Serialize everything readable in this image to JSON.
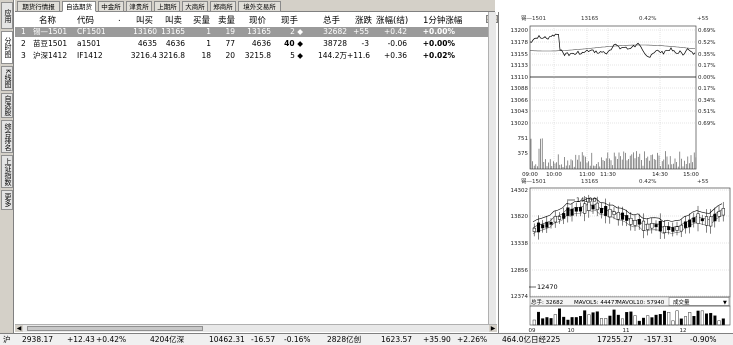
{
  "sidebar": [
    "应用",
    "分时图",
    "K线图",
    "自选股",
    "综合排名",
    "上证指数",
    "更多"
  ],
  "tabs": [
    "期货行情报",
    "自选期货",
    "中金所",
    "津贵所",
    "上期所",
    "大商所",
    "郑商所",
    "境外交易所"
  ],
  "nav_arrows": "◀▶",
  "columns": [
    "名称",
    "代码",
    ".",
    "叫买",
    "叫卖",
    "买量",
    "卖量",
    "现价",
    "现手",
    "总手",
    "涨跌",
    "涨幅(结)",
    "1分钟涨幅"
  ],
  "rows": [
    {
      "idx": "1",
      "name": "锡—1501",
      "code": "CF1501",
      "bid": "13160",
      "ask": "13165",
      "bidvol": "1",
      "askvol": "19",
      "price": "13165",
      "cur": "2 ◆",
      "total": "32682",
      "chg": "+55",
      "pct": "+0.42",
      "min1": "+0.00%"
    },
    {
      "idx": "2",
      "name": "苗豆1501",
      "code": "a1501",
      "bid": "4635",
      "ask": "4636",
      "bidvol": "1",
      "askvol": "77",
      "price": "4636",
      "cur": "40 ◆",
      "total": "38728",
      "chg": "-3",
      "pct": "-0.06",
      "min1": "+0.00%"
    },
    {
      "idx": "3",
      "name": "沪深1412",
      "code": "IF1412",
      "bid": "3216.4",
      "ask": "3216.8",
      "bidvol": "18",
      "askvol": "20",
      "price": "3215.8",
      "cur": "5 ◆",
      "total": "144.2万",
      "chg": "+11.6",
      "pct": "+0.36",
      "min1": "+0.02%"
    }
  ],
  "intraday": {
    "header": {
      "name": "锡—1501",
      "price": "13165",
      "pct": "0.42%",
      "chg": "+55"
    },
    "left_ticks": [
      "13200",
      "13178",
      "13155",
      "13133",
      "13110",
      "13088",
      "13066",
      "13043",
      "13020",
      "751",
      "375"
    ],
    "right_ticks": [
      "0.69%",
      "0.52%",
      "0.35%",
      "0.17%",
      "0.00%",
      "0.17%",
      "0.34%",
      "0.51%",
      "0.69%"
    ],
    "time_ticks": [
      "09:00",
      "10:00",
      "11:00",
      "11:30",
      "14:30",
      "15:00"
    ]
  },
  "kline": {
    "header": {
      "name": "锡—1501",
      "price": "13165",
      "pct": "0.42%",
      "chg": "+55"
    },
    "left_ticks": [
      "14302",
      "13820",
      "13338",
      "12856",
      "12374"
    ],
    "high_label": "14100",
    "low_label": "12470",
    "indicator": {
      "vol": "总手: 32682",
      "mavol5": "MAVOL5: 44477",
      "mavol10": "MAVOL10: 57940",
      "dropdown": "成交量"
    },
    "date_ticks": [
      "09",
      "10",
      "11",
      "12"
    ]
  },
  "status": [
    "沪",
    "2938.17",
    "+12.43",
    "+0.42%",
    "4204亿深",
    "10462.31",
    "-16.57",
    "-0.16%",
    "2828亿创",
    "1623.57",
    "+35.90",
    "+2.26%",
    "464.0亿日经225",
    "17255.27",
    "-157.31",
    "-0.90%"
  ]
}
